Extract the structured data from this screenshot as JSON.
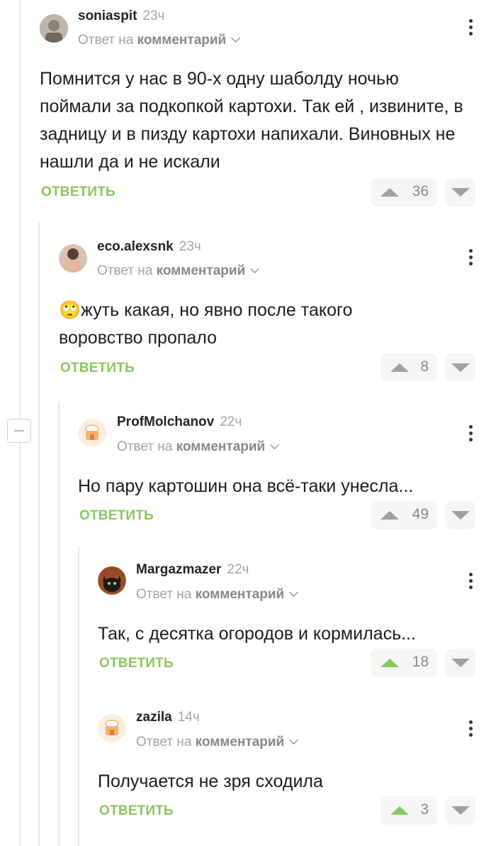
{
  "colors": {
    "accent_green": "#8ac858",
    "muted": "#a3a3a3",
    "thread_line": "#e6e6e6"
  },
  "comments": [
    {
      "author": "soniaspit",
      "time": "23ч",
      "reply_prefix": "Ответ на",
      "reply_link": "комментарий",
      "text": "Помнится у нас в 90-х одну шаболду ночью поймали за подкопкой картохи. Так ей , извините, в задницу и в пизду картохи напихали. Виновных не нашли да и не искали",
      "reply_label": "ОТВЕТИТЬ",
      "rating": "36",
      "voted_up": false
    },
    {
      "author": "eco.alexsnk",
      "time": "23ч",
      "reply_prefix": "Ответ на",
      "reply_link": "комментарий",
      "emoji": "🙄",
      "text": "жуть какая, но явно после такого воровство пропало",
      "reply_label": "ОТВЕТИТЬ",
      "rating": "8",
      "voted_up": false
    },
    {
      "author": "ProfMolchanov",
      "time": "22ч",
      "reply_prefix": "Ответ на",
      "reply_link": "комментарий",
      "text": "Но пару картошин она всё-таки унесла...",
      "reply_label": "ОТВЕТИТЬ",
      "rating": "49",
      "voted_up": false
    },
    {
      "author": "Margazmazer",
      "time": "22ч",
      "reply_prefix": "Ответ на",
      "reply_link": "комментарий",
      "text": "Так, с десятка огородов и кормилась...",
      "reply_label": "ОТВЕТИТЬ",
      "rating": "18",
      "voted_up": true
    },
    {
      "author": "zazila",
      "time": "14ч",
      "reply_prefix": "Ответ на",
      "reply_link": "комментарий",
      "text": "Получается не зря сходила",
      "reply_label": "ОТВЕТИТЬ",
      "rating": "3",
      "voted_up": true
    }
  ]
}
